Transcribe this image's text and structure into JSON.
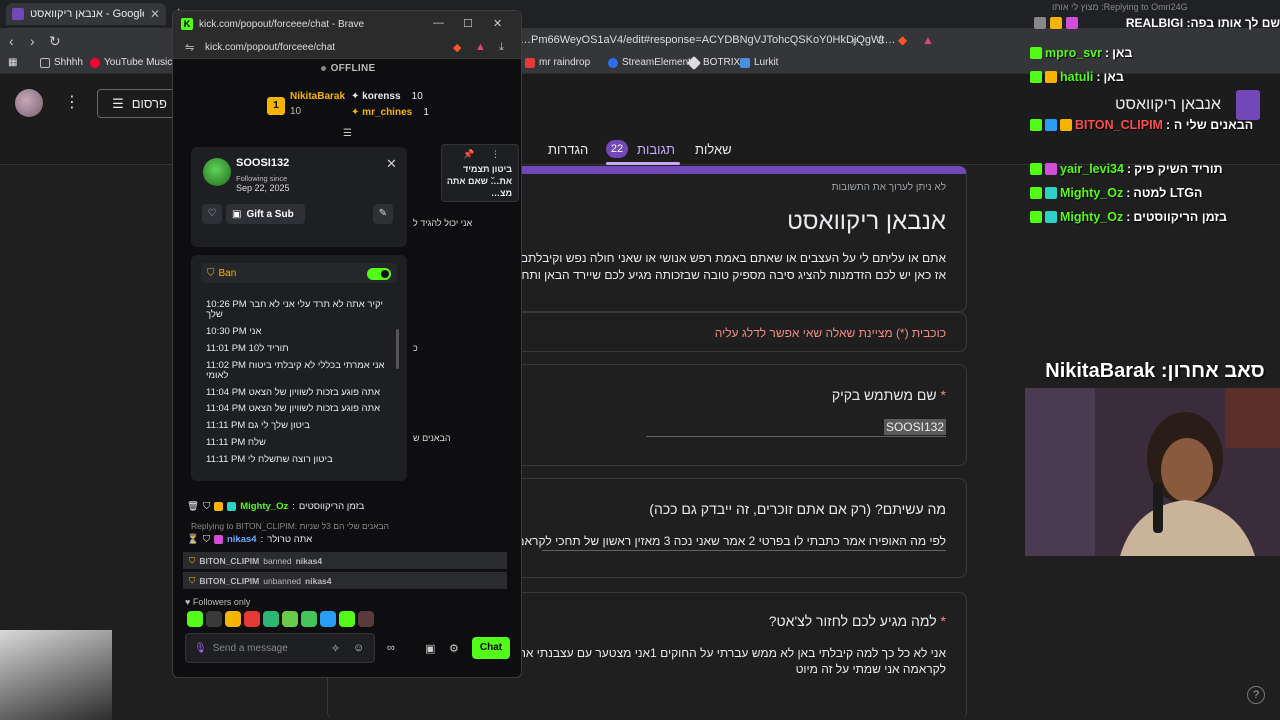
{
  "browser": {
    "tab_title": "אנבאן ריקוואסט - Google Forms",
    "url": "…Pm66WeyOS1aV4/edit#response=ACYDBNgVJTohcQSKoY0HkDjQgWt…",
    "bookmarks": [
      "Shhhh",
      "YouTube Music",
      "mr raindrop",
      "StreamElements",
      "BOTRIX",
      "Lurkit"
    ]
  },
  "forms": {
    "publish_label": "פרסום",
    "doc_title": "אנבאן ריקוואסט",
    "tabs": [
      "שאלות",
      "תגובות",
      "הגדרות"
    ],
    "responses_count": "22",
    "note": "לא ניתן לערוך את התשובות",
    "title": "אנבאן ריקוואסט",
    "description": "אתם או עליתם לי על העצבים או שאתם באמת רפש אנושי או שאני חולה נפש וקיבלתם בגלל זה באן !kick.com/forceee\nאז כאן יש לכם הזדמנות להציג סיבה מספיק טובה שבזכותה מגיע לכם שיירד הבאן ותחזרו א",
    "required_note": "כוכבית (*) מציינת שאלה שאי אפשר לדלג עליה",
    "questions": [
      {
        "title": "שם משתמש בקיק",
        "required": true,
        "answer": "SOOSI132"
      },
      {
        "title": "מה עשיתם? (רק אם אתם זוכרים, זה ייבדק גם ככה)",
        "required": false,
        "answer": "לפי מה האופירו אמר כתבתי לו בפרטי 2 אמר שאני נכה 3 מאזין ראשון של תחכי לקראמה"
      },
      {
        "title": "למה מגיע לכם לחזור לצ'אט?",
        "required": true,
        "answer": "אני לא כל כך למה קיבלתי באן לא ממש עברתי על החוקים 1אני מצטער עם עצבנתי את אופירו\nלקראמה אני שמתי על זה מיוט"
      }
    ]
  },
  "popout": {
    "window_title": "kick.com/popout/forceee/chat - Brave",
    "url": "kick.com/popout/forceee/chat",
    "status": "OFFLINE",
    "gifters": [
      {
        "rank": "1",
        "name": "NikitaBarak",
        "count": "10"
      },
      {
        "name": "korenss",
        "count": "10"
      },
      {
        "name": "mr_chines",
        "count": "1"
      }
    ],
    "pinned_text": "ביטון תצמיד את… שאם אתה מצ…",
    "chat_fragments": [
      "אני יכול להגיד ל",
      "כ",
      "הבאנים ש"
    ],
    "messages": [
      {
        "user": "Mighty_Oz",
        "text": "בזמן הריקווסטים"
      },
      {
        "user": "nikas4",
        "text": "אתה טרולר"
      }
    ],
    "reply_note": "Replying to BITON_CLIPIM: הבאנים שלי הם 3ל שניות",
    "mod_actions": [
      {
        "actor": "BITON_CLIPIM",
        "action": "banned",
        "target": "nikas4"
      },
      {
        "actor": "BITON_CLIPIM",
        "action": "unbanned",
        "target": "nikas4"
      }
    ],
    "followers_only": "Followers only",
    "input_placeholder": "Send a message",
    "send_label": "Chat"
  },
  "user_card": {
    "username": "SOOSI132",
    "following_label": "Following since",
    "following_date": "Sep 22, 2025",
    "gift_label": "Gift a Sub",
    "ban_label": "Ban",
    "history": [
      {
        "time": "10:26 PM",
        "text": "יקיר אתה לא תרד עלי אני לא חבר שלך"
      },
      {
        "time": "10:30 PM",
        "text": "אני"
      },
      {
        "time": "11:01 PM",
        "text": "תוריד ל10"
      },
      {
        "time": "11:02 PM",
        "text": "אני אמרתי בכללי לא קיבלתי ביטוח לאומי"
      },
      {
        "time": "11:04 PM",
        "text": "אתה פוגע בזכות לשוויון של הצאט"
      },
      {
        "time": "11:04 PM",
        "text": "אתה פוגע בזכות לשוויון של הצאט"
      },
      {
        "time": "11:11 PM",
        "text": "ביטון שלך לי גם"
      },
      {
        "time": "11:11 PM",
        "text": "שלח"
      },
      {
        "time": "11:11 PM",
        "text": "ביטון רוצה שתשלח לי"
      }
    ]
  },
  "overlay": {
    "reply_note": "Replying to Omri24G: מצוץ לי אותו",
    "top_line": "שם לך אותו בפה: REALBIGI",
    "chat": [
      {
        "user": "mpro_svr",
        "text": "באן",
        "red": false
      },
      {
        "user": "hatuli",
        "text": "באן",
        "red": false
      },
      {
        "user": "BITON_CLIPIM",
        "text": "הבאנים שלי הם 3ל שניות",
        "red": true
      },
      {
        "user": "yair_levi34",
        "text": "תוריד השיק פיק",
        "red": false
      },
      {
        "user": "Mighty_Oz",
        "text": "למטה LTGה",
        "red": false
      },
      {
        "user": "Mighty_Oz",
        "text": "בזמן הריקווסטים",
        "red": false
      }
    ],
    "sub_banner": "סאב אחרון: NikitaBarak"
  },
  "colors": {
    "kick_green": "#53fc18",
    "forms_purple": "#7248b9",
    "required_red": "#f28b82",
    "gold": "#f5b400"
  }
}
